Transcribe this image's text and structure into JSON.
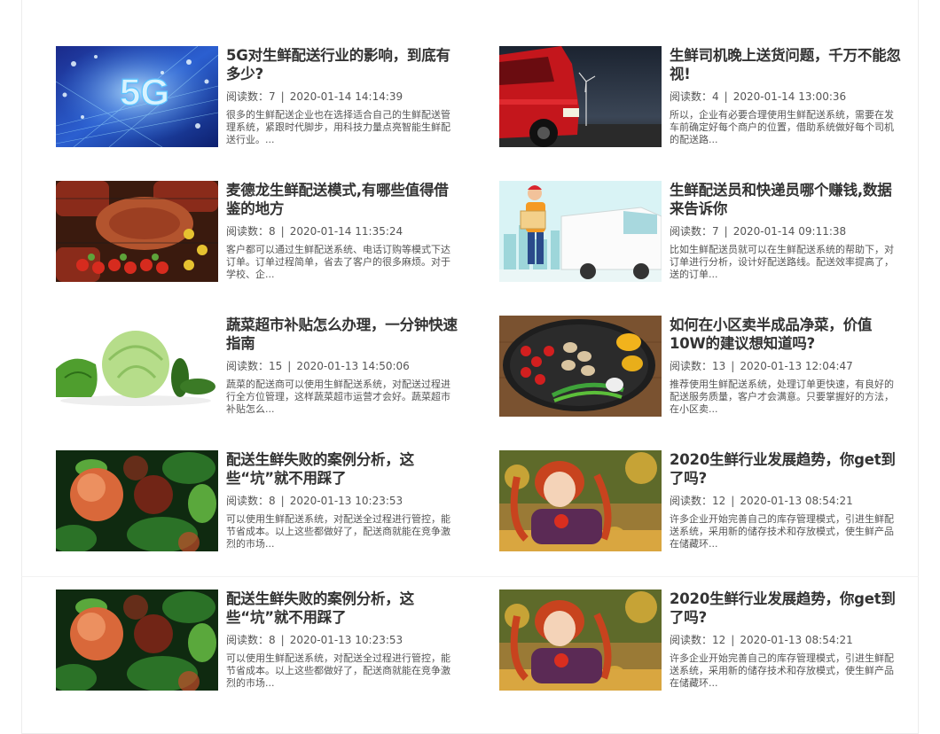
{
  "articles": [
    {
      "title": "5G对生鲜配送行业的影响，到底有多少?",
      "reads_label": "阅读数：",
      "reads": "7",
      "date": "2020-01-14 14:14:39",
      "summary": "很多的生鲜配送企业也在选择适合自己的生鲜配送管理系统，紧跟时代脚步，用科技力量点亮智能生鲜配送行业。...",
      "thumb_icon": "5g-network-image"
    },
    {
      "title": "生鲜司机晚上送货问题，千万不能忽视!",
      "reads_label": "阅读数：",
      "reads": "4",
      "date": "2020-01-14 13:00:36",
      "summary": "所以，企业有必要合理使用生鲜配送系统，需要在发车前确定好每个商户的位置，借助系统做好每个司机的配送路...",
      "thumb_icon": "night-truck-image"
    },
    {
      "title": "麦德龙生鲜配送模式,有哪些值得借鉴的地方",
      "reads_label": "阅读数：",
      "reads": "8",
      "date": "2020-01-14 11:35:24",
      "summary": "客户都可以通过生鲜配送系统、电话订购等模式下达订单。订单过程简单，省去了客户的很多麻烦。对于学校、企...",
      "thumb_icon": "bbq-food-image"
    },
    {
      "title": "生鲜配送员和快递员哪个赚钱,数据来告诉你",
      "reads_label": "阅读数：",
      "reads": "7",
      "date": "2020-01-14 09:11:38",
      "summary": "比如生鲜配送员就可以在生鲜配送系统的帮助下，对订单进行分析，设计好配送路线。配送效率提高了，送的订单...",
      "thumb_icon": "delivery-man-van-image"
    },
    {
      "title": "蔬菜超市补贴怎么办理，一分钟快速指南",
      "reads_label": "阅读数：",
      "reads": "15",
      "date": "2020-01-13 14:50:06",
      "summary": "蔬菜的配送商可以使用生鲜配送系统，对配送过程进行全方位管理，这样蔬菜超市运营才会好。蔬菜超市补贴怎么...",
      "thumb_icon": "cabbage-cucumber-image"
    },
    {
      "title": "如何在小区卖半成品净菜，价值10W的建议想知道吗?",
      "reads_label": "阅读数：",
      "reads": "13",
      "date": "2020-01-13 12:04:47",
      "summary": "推荐使用生鲜配送系统，处理订单更快速，有良好的配送服务质量，客户才会满意。只要掌握好的方法，在小区卖...",
      "thumb_icon": "vegetable-pan-image"
    },
    {
      "title": "配送生鲜失败的案例分析，这些“坑”就不用踩了",
      "reads_label": "阅读数：",
      "reads": "8",
      "date": "2020-01-13 10:23:53",
      "summary": "可以使用生鲜配送系统，对配送全过程进行管控，能节省成本。以上这些都做好了，配送商就能在竞争激烈的市场...",
      "thumb_icon": "peach-tree-image"
    },
    {
      "title": "2020生鲜行业发展趋势，你get到了吗?",
      "reads_label": "阅读数：",
      "reads": "12",
      "date": "2020-01-13 08:54:21",
      "summary": "许多企业开始完善自己的库存管理模式，引进生鲜配送系统，采用新的储存技术和存放模式，使生鲜产品在储藏环...",
      "thumb_icon": "girl-apple-image"
    },
    {
      "title": "配送生鲜失败的案例分析，这些“坑”就不用踩了",
      "reads_label": "阅读数：",
      "reads": "8",
      "date": "2020-01-13 10:23:53",
      "summary": "可以使用生鲜配送系统，对配送全过程进行管控，能节省成本。以上这些都做好了，配送商就能在竞争激烈的市场...",
      "thumb_icon": "peach-tree-image"
    },
    {
      "title": "2020生鲜行业发展趋势，你get到了吗?",
      "reads_label": "阅读数：",
      "reads": "12",
      "date": "2020-01-13 08:54:21",
      "summary": "许多企业开始完善自己的库存管理模式，引进生鲜配送系统，采用新的储存技术和存放模式，使生鲜产品在储藏环...",
      "thumb_icon": "girl-apple-image"
    }
  ],
  "meta_separator": "|",
  "thumb_text_5g": "5G"
}
